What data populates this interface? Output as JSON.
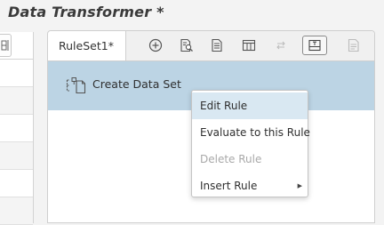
{
  "app": {
    "title": "Data Transformer *"
  },
  "tabs": [
    {
      "label": "RuleSet1*"
    }
  ],
  "toolbar": {
    "icons": [
      "add-circle-icon",
      "search-document-icon",
      "document-icon",
      "table-icon",
      "swap-arrows-icon",
      "text-box-icon",
      "disabled-list-icon"
    ]
  },
  "rule": {
    "label": "Create Data Set",
    "icon": "dataset-create-icon"
  },
  "context_menu": {
    "items": [
      {
        "label": "Edit Rule",
        "state": "hover"
      },
      {
        "label": "Evaluate to this Rule",
        "state": "enabled"
      },
      {
        "label": "Delete Rule",
        "state": "disabled"
      },
      {
        "label": "Insert Rule",
        "state": "submenu"
      }
    ]
  },
  "colors": {
    "selected_row": "#bcd4e4",
    "menu_hover": "#d9e8f2",
    "disabled_text": "#a9a9a9"
  }
}
